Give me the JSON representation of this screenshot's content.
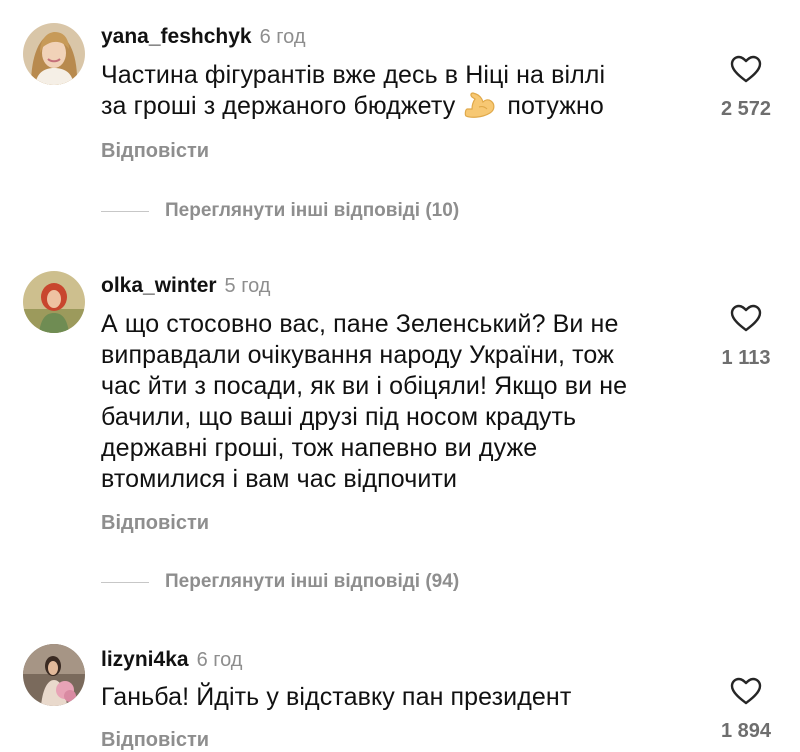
{
  "comments": [
    {
      "username": "yana_feshchyk",
      "time": "6 год",
      "text_line1": "Частина фігурантів вже десь в Ніці на віллі",
      "text_line2_before": "за гроші з держаного бюджету",
      "text_line2_after": "потужно",
      "emoji": "flexed-biceps-icon",
      "likes": "2 572",
      "reply": "Відповісти",
      "view_replies": "Переглянути інші відповіді (10)"
    },
    {
      "username": "olka_winter",
      "time": "5 год",
      "lines": [
        "А що стосовно вас, пане Зеленський? Ви не",
        "виправдали очікування народу України, тож",
        "час йти з посади, як ви і обіцяли! Якщо ви не",
        "бачили, що ваші друзі під носом крадуть",
        "державні гроші, тож напевно ви дуже",
        "втомилися і вам час відпочити"
      ],
      "likes": "1 113",
      "reply": "Відповісти",
      "view_replies": "Переглянути інші відповіді (94)"
    },
    {
      "username": "lizyni4ka",
      "time": "6 год",
      "text": "Ганьба! Йдіть у відставку пан президент",
      "likes": "1 894",
      "reply": "Відповісти"
    }
  ],
  "icons": {
    "like": "heart-outline-icon"
  }
}
